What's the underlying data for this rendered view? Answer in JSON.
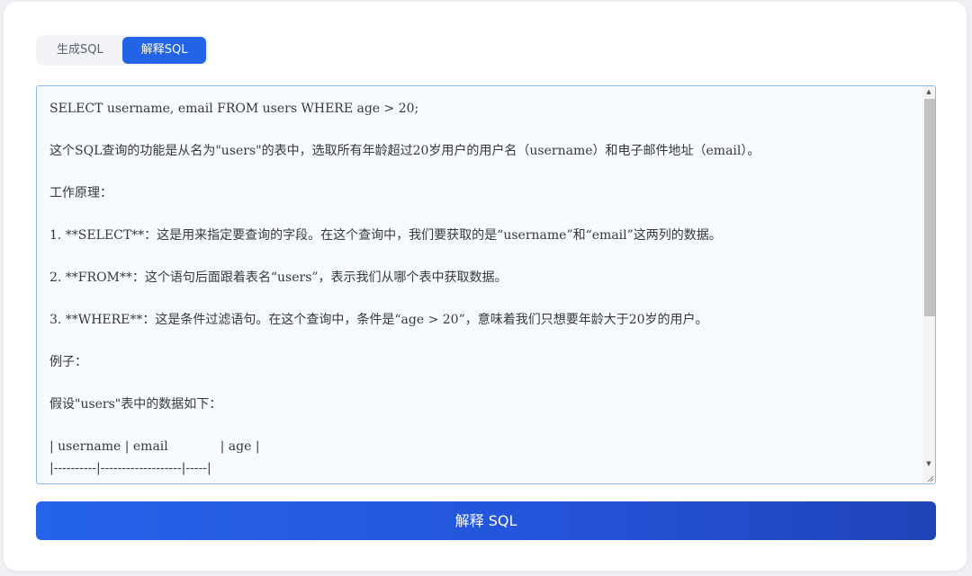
{
  "tabs": [
    {
      "label": "生成SQL",
      "active": false
    },
    {
      "label": "解释SQL",
      "active": true
    }
  ],
  "editor": {
    "lines": [
      "SELECT username, email FROM users WHERE age > 20;",
      "",
      "这个SQL查询的功能是从名为\"users\"的表中，选取所有年龄超过20岁用户的用户名（username）和电子邮件地址（email）。",
      "",
      "工作原理：",
      "",
      "1. **SELECT**：这是用来指定要查询的字段。在这个查询中，我们要获取的是“username”和“email”这两列的数据。",
      "",
      "2. **FROM**：这个语句后面跟着表名“users”，表示我们从哪个表中获取数据。",
      "",
      "3. **WHERE**：这是条件过滤语句。在这个查询中，条件是“age > 20”，意味着我们只想要年龄大于20岁的用户。",
      "",
      "例子：",
      "",
      "假设\"users\"表中的数据如下：",
      "",
      "| username | email             | age |",
      "|----------|-------------------|-----|"
    ]
  },
  "action": {
    "label": "解释 SQL"
  },
  "colors": {
    "accent": "#2264e5",
    "editor_border": "#8fb6ee",
    "editor_bg": "#f7fafd"
  }
}
